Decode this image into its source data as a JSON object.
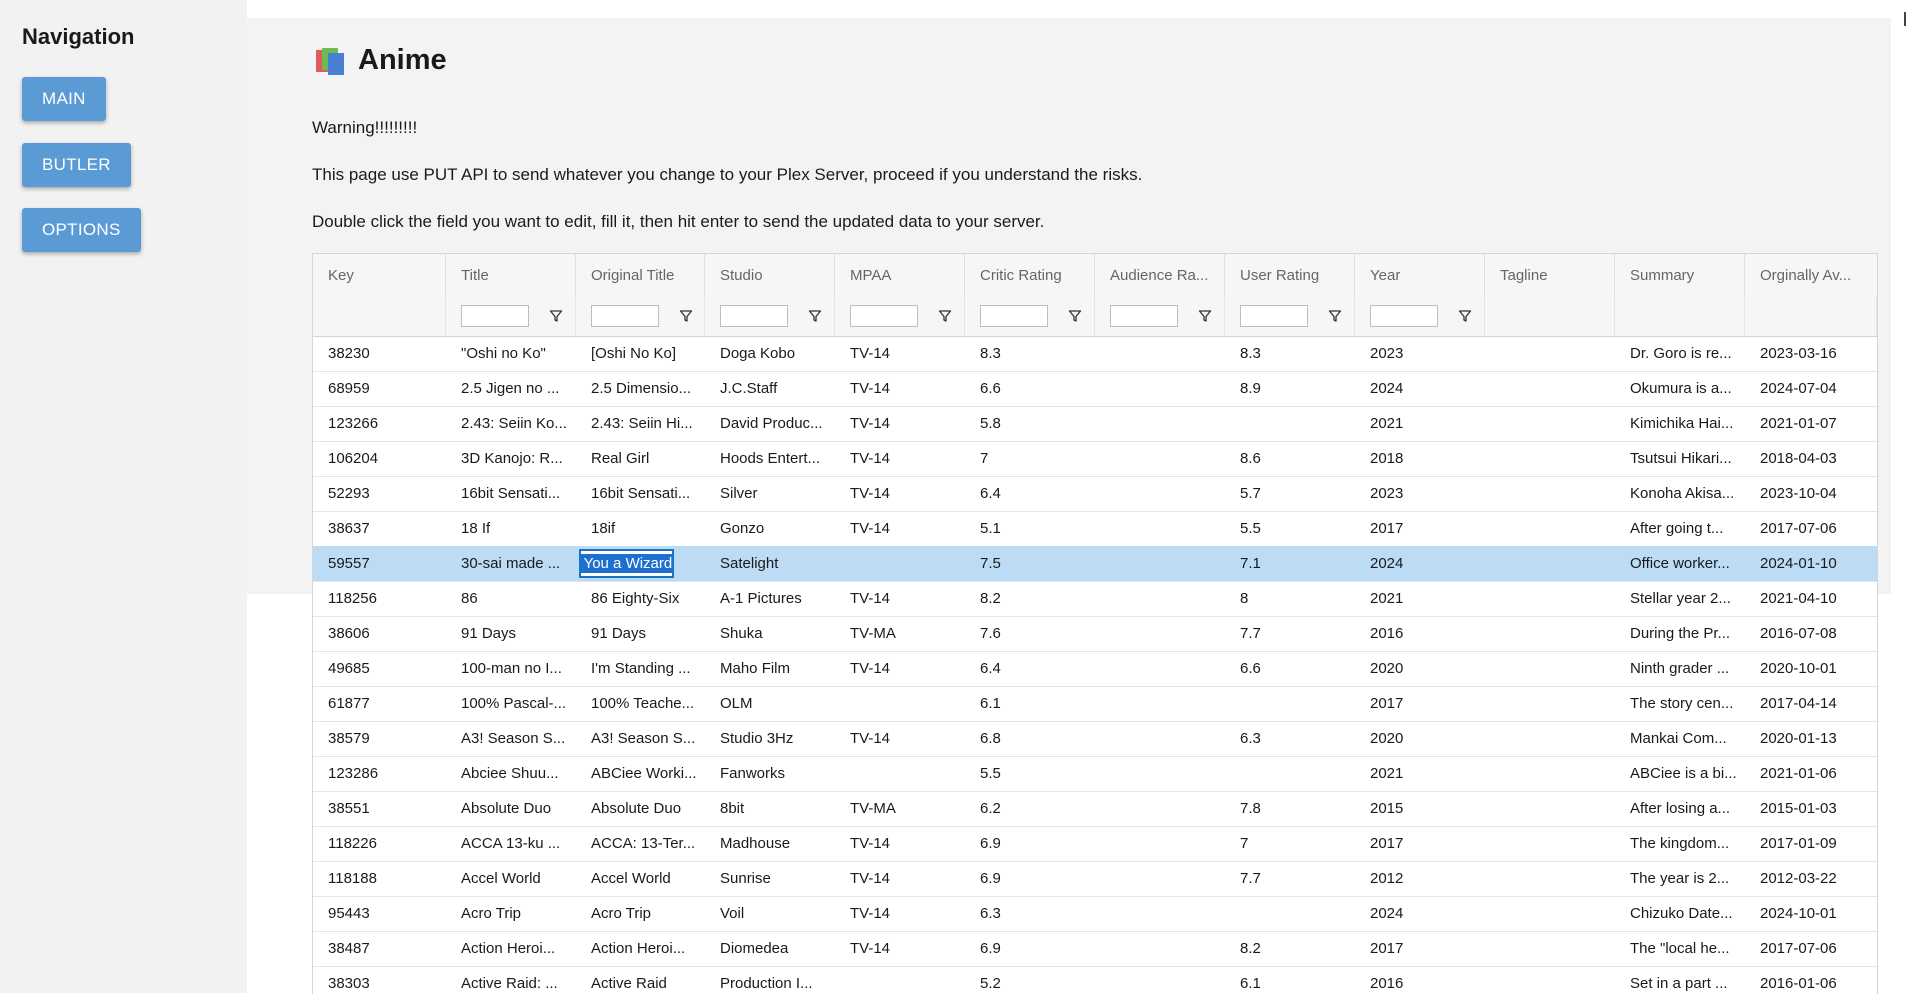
{
  "sidebar": {
    "title": "Navigation",
    "buttons": [
      {
        "label": "MAIN"
      },
      {
        "label": "BUTLER"
      },
      {
        "label": "OPTIONS"
      }
    ]
  },
  "page": {
    "title": "Anime",
    "icon": "books-icon",
    "warning": "Warning!!!!!!!!!",
    "info": "This page use PUT API to send whatever you change to your Plex Server, proceed if you understand the risks.",
    "instruction": "Double click the field you want to edit, fill it, then hit enter to send the updated data to your server."
  },
  "grid": {
    "columns": [
      "Key",
      "Title",
      "Original Title",
      "Studio",
      "MPAA",
      "Critic Rating",
      "Audience Ra...",
      "User Rating",
      "Year",
      "Tagline",
      "Summary",
      "Orginally Av..."
    ],
    "editing_value": "Make You a Wizard?!",
    "rows": [
      [
        "38230",
        "\"Oshi no Ko\"",
        "[Oshi No Ko]",
        "Doga Kobo",
        "TV-14",
        "8.3",
        "",
        "8.3",
        "2023",
        "",
        "Dr. Goro is re...",
        "2023-03-16"
      ],
      [
        "68959",
        "2.5 Jigen no ...",
        "2.5 Dimensio...",
        "J.C.Staff",
        "TV-14",
        "6.6",
        "",
        "8.9",
        "2024",
        "",
        "Okumura is a...",
        "2024-07-04"
      ],
      [
        "123266",
        "2.43: Seiin Ko...",
        "2.43: Seiin Hi...",
        "David Produc...",
        "TV-14",
        "5.8",
        "",
        "",
        "2021",
        "",
        "Kimichika Hai...",
        "2021-01-07"
      ],
      [
        "106204",
        "3D Kanojo: R...",
        "Real Girl",
        "Hoods Entert...",
        "TV-14",
        "7",
        "",
        "8.6",
        "2018",
        "",
        "Tsutsui Hikari...",
        "2018-04-03"
      ],
      [
        "52293",
        "16bit Sensati...",
        "16bit Sensati...",
        "Silver",
        "TV-14",
        "6.4",
        "",
        "5.7",
        "2023",
        "",
        "Konoha Akisa...",
        "2023-10-04"
      ],
      [
        "38637",
        "18 If",
        "18if",
        "Gonzo",
        "TV-14",
        "5.1",
        "",
        "5.5",
        "2017",
        "",
        "After going t...",
        "2017-07-06"
      ],
      [
        "59557",
        "30-sai made ...",
        "",
        "Satelight",
        "",
        "7.5",
        "",
        "7.1",
        "2024",
        "",
        "Office worker...",
        "2024-01-10"
      ],
      [
        "118256",
        "86",
        "86 Eighty-Six",
        "A-1 Pictures",
        "TV-14",
        "8.2",
        "",
        "8",
        "2021",
        "",
        "Stellar year 2...",
        "2021-04-10"
      ],
      [
        "38606",
        "91 Days",
        "91 Days",
        "Shuka",
        "TV-MA",
        "7.6",
        "",
        "7.7",
        "2016",
        "",
        "During the Pr...",
        "2016-07-08"
      ],
      [
        "49685",
        "100-man no I...",
        "I'm Standing ...",
        "Maho Film",
        "TV-14",
        "6.4",
        "",
        "6.6",
        "2020",
        "",
        "Ninth grader ...",
        "2020-10-01"
      ],
      [
        "61877",
        "100% Pascal-...",
        "100% Teache...",
        "OLM",
        "",
        "6.1",
        "",
        "",
        "2017",
        "",
        "The story cen...",
        "2017-04-14"
      ],
      [
        "38579",
        "A3! Season S...",
        "A3! Season S...",
        "Studio 3Hz",
        "TV-14",
        "6.8",
        "",
        "6.3",
        "2020",
        "",
        "Mankai Com...",
        "2020-01-13"
      ],
      [
        "123286",
        "Abciee Shuu...",
        "ABCiee Worki...",
        "Fanworks",
        "",
        "5.5",
        "",
        "",
        "2021",
        "",
        "ABCiee is a bi...",
        "2021-01-06"
      ],
      [
        "38551",
        "Absolute Duo",
        "Absolute Duo",
        "8bit",
        "TV-MA",
        "6.2",
        "",
        "7.8",
        "2015",
        "",
        "After losing a...",
        "2015-01-03"
      ],
      [
        "118226",
        "ACCA 13-ku ...",
        "ACCA: 13-Ter...",
        "Madhouse",
        "TV-14",
        "6.9",
        "",
        "7",
        "2017",
        "",
        "The kingdom...",
        "2017-01-09"
      ],
      [
        "118188",
        "Accel World",
        "Accel World",
        "Sunrise",
        "TV-14",
        "6.9",
        "",
        "7.7",
        "2012",
        "",
        "The year is 2...",
        "2012-03-22"
      ],
      [
        "95443",
        "Acro Trip",
        "Acro Trip",
        "Voil",
        "TV-14",
        "6.3",
        "",
        "",
        "2024",
        "",
        "Chizuko Date...",
        "2024-10-01"
      ],
      [
        "38487",
        "Action Heroi...",
        "Action Heroi...",
        "Diomedea",
        "TV-14",
        "6.9",
        "",
        "8.2",
        "2017",
        "",
        "The \"local he...",
        "2017-07-06"
      ],
      [
        "38303",
        "Active Raid: ...",
        "Active Raid",
        "Production I...",
        "",
        "5.2",
        "",
        "6.1",
        "2016",
        "",
        "Set in a part ...",
        "2016-01-06"
      ]
    ]
  }
}
